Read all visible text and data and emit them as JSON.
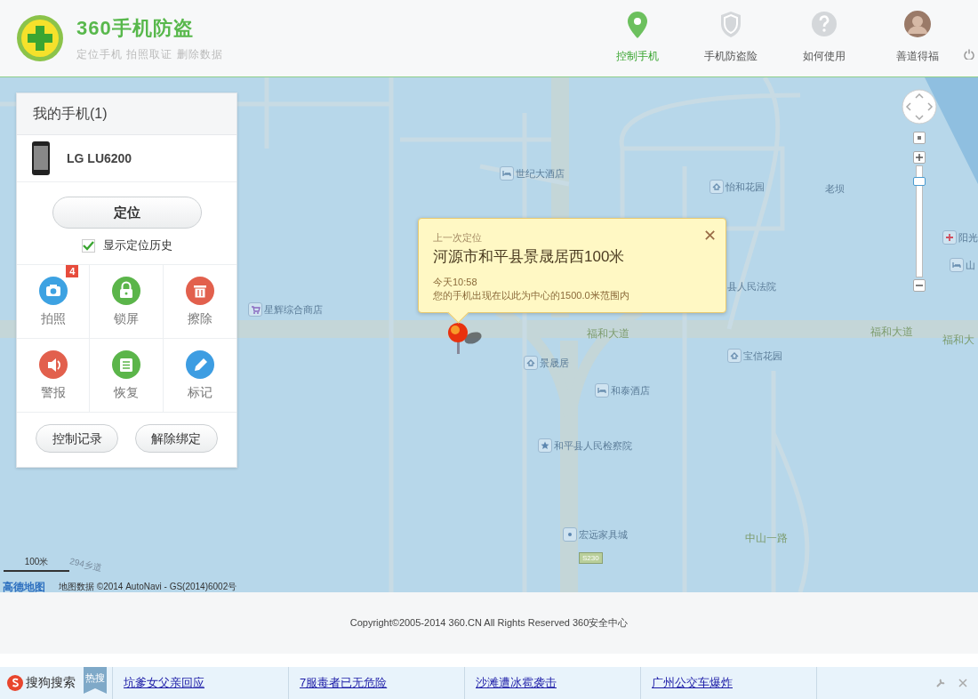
{
  "header": {
    "brand": "360手机防盗",
    "tagline": "定位手机 拍照取证 删除数据",
    "nav": [
      {
        "label": "控制手机",
        "kind": "pin",
        "selected": true
      },
      {
        "label": "手机防盗险",
        "kind": "shield",
        "selected": false
      },
      {
        "label": "如何使用",
        "kind": "help",
        "selected": false
      },
      {
        "label": "善道得福",
        "kind": "avatar",
        "selected": false
      }
    ]
  },
  "map": {
    "places": [
      {
        "name": "世纪大酒店",
        "kind": "hotel"
      },
      {
        "name": "怡和花园",
        "kind": "residence"
      },
      {
        "name": "老坝",
        "kind": "plain"
      },
      {
        "name": "阳光",
        "kind": "hospital"
      },
      {
        "name": "山",
        "kind": "hotel"
      },
      {
        "name": "县人民法院",
        "kind": "plain"
      },
      {
        "name": "星辉综合商店",
        "kind": "shop"
      },
      {
        "name": "福和大道",
        "kind": "road"
      },
      {
        "name": "福和大道",
        "kind": "road"
      },
      {
        "name": "福和大",
        "kind": "road"
      },
      {
        "name": "景晟居",
        "kind": "residence"
      },
      {
        "name": "宝信花园",
        "kind": "residence"
      },
      {
        "name": "和泰酒店",
        "kind": "hotel"
      },
      {
        "name": "和平县人民检察院",
        "kind": "star"
      },
      {
        "name": "宏远家具城",
        "kind": "dot"
      },
      {
        "name": "中山一路",
        "kind": "road"
      },
      {
        "name": "294乡道",
        "kind": "road"
      },
      {
        "name": "S230",
        "kind": "route"
      }
    ],
    "popup": {
      "label": "上一次定位",
      "address": "河源市和平县景晟居西100米",
      "time": "今天10:58",
      "note": "您的手机出现在以此为中心的1500.0米范围内",
      "close": "✕"
    },
    "zoom": {
      "level": 0.9
    },
    "scale": "100米",
    "provider": "高德地图",
    "attribution": "地图数据 ©2014 AutoNavi - GS(2014)6002号"
  },
  "panel": {
    "title": "我的手机(1)",
    "device": "LG LU6200",
    "locate": "定位",
    "show_history": {
      "label": "显示定位历史",
      "checked": true
    },
    "actions": [
      {
        "label": "拍照",
        "kind": "camera",
        "color": "#3da2e2",
        "badge": "4"
      },
      {
        "label": "锁屏",
        "kind": "lock",
        "color": "#5bb54a"
      },
      {
        "label": "擦除",
        "kind": "trash",
        "color": "#e2604d"
      },
      {
        "label": "警报",
        "kind": "speaker",
        "color": "#e2604d"
      },
      {
        "label": "恢复",
        "kind": "list",
        "color": "#5bb54a"
      },
      {
        "label": "标记",
        "kind": "pencil",
        "color": "#3d9de2"
      }
    ],
    "buttons": [
      "控制记录",
      "解除绑定"
    ]
  },
  "footer": {
    "copyright": "Copyright©2005-2014 360.CN All Rights Reserved 360安全中心"
  },
  "news_bar": {
    "brand": "搜狗搜索",
    "tag": "热搜",
    "links": [
      "坑爹女父亲回应",
      "7服毒者已无危险",
      "沙滩遭冰雹袭击",
      "广州公交车爆炸"
    ]
  }
}
